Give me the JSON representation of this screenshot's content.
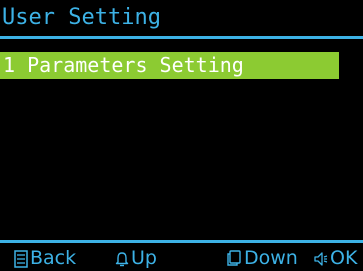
{
  "screen": {
    "title": "User Setting"
  },
  "menu": {
    "items": [
      {
        "label": "1 Parameters Setting",
        "selected": true
      }
    ]
  },
  "footer": {
    "back_label": "Back",
    "back_icon": "list-icon",
    "up_label": "Up",
    "up_icon": "bell-icon",
    "down_label": "Down",
    "down_icon": "copy-icon",
    "ok_label": "OK",
    "ok_icon": "speaker-icon"
  },
  "colors": {
    "background": "#000000",
    "accent": "#3db2e6",
    "selection": "#8ccb32",
    "selected_text": "#ffffff"
  }
}
